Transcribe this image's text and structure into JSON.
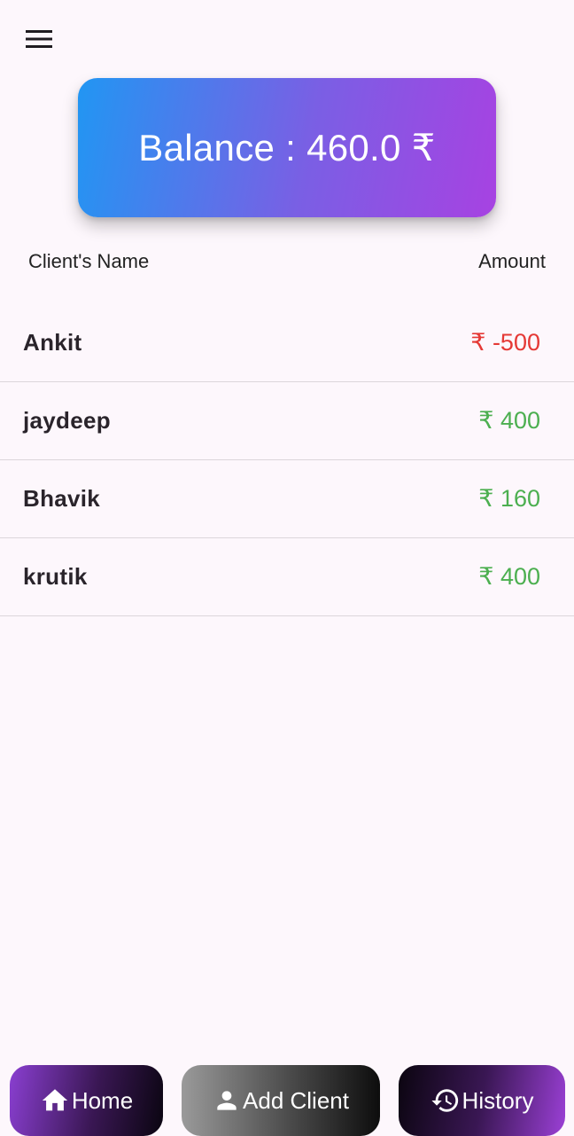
{
  "header": {
    "menu_icon": "hamburger-menu-icon"
  },
  "balance": {
    "label": "Balance : 460.0 ₹",
    "gradient_start": "#2196f3",
    "gradient_end": "#a742e2"
  },
  "columns": {
    "name_header": "Client's Name",
    "amount_header": "Amount"
  },
  "clients": [
    {
      "name": "Ankit",
      "amount": "₹ -500",
      "color": "#e53935"
    },
    {
      "name": "jaydeep",
      "amount": "₹ 400",
      "color": "#4caf50"
    },
    {
      "name": "Bhavik",
      "amount": "₹ 160",
      "color": "#4caf50"
    },
    {
      "name": "krutik",
      "amount": "₹ 400",
      "color": "#4caf50"
    }
  ],
  "nav": {
    "home_label": "Home",
    "home_icon": "home-icon",
    "add_label": "Add Client",
    "add_icon": "person-icon",
    "history_label": "History",
    "history_icon": "history-icon"
  }
}
